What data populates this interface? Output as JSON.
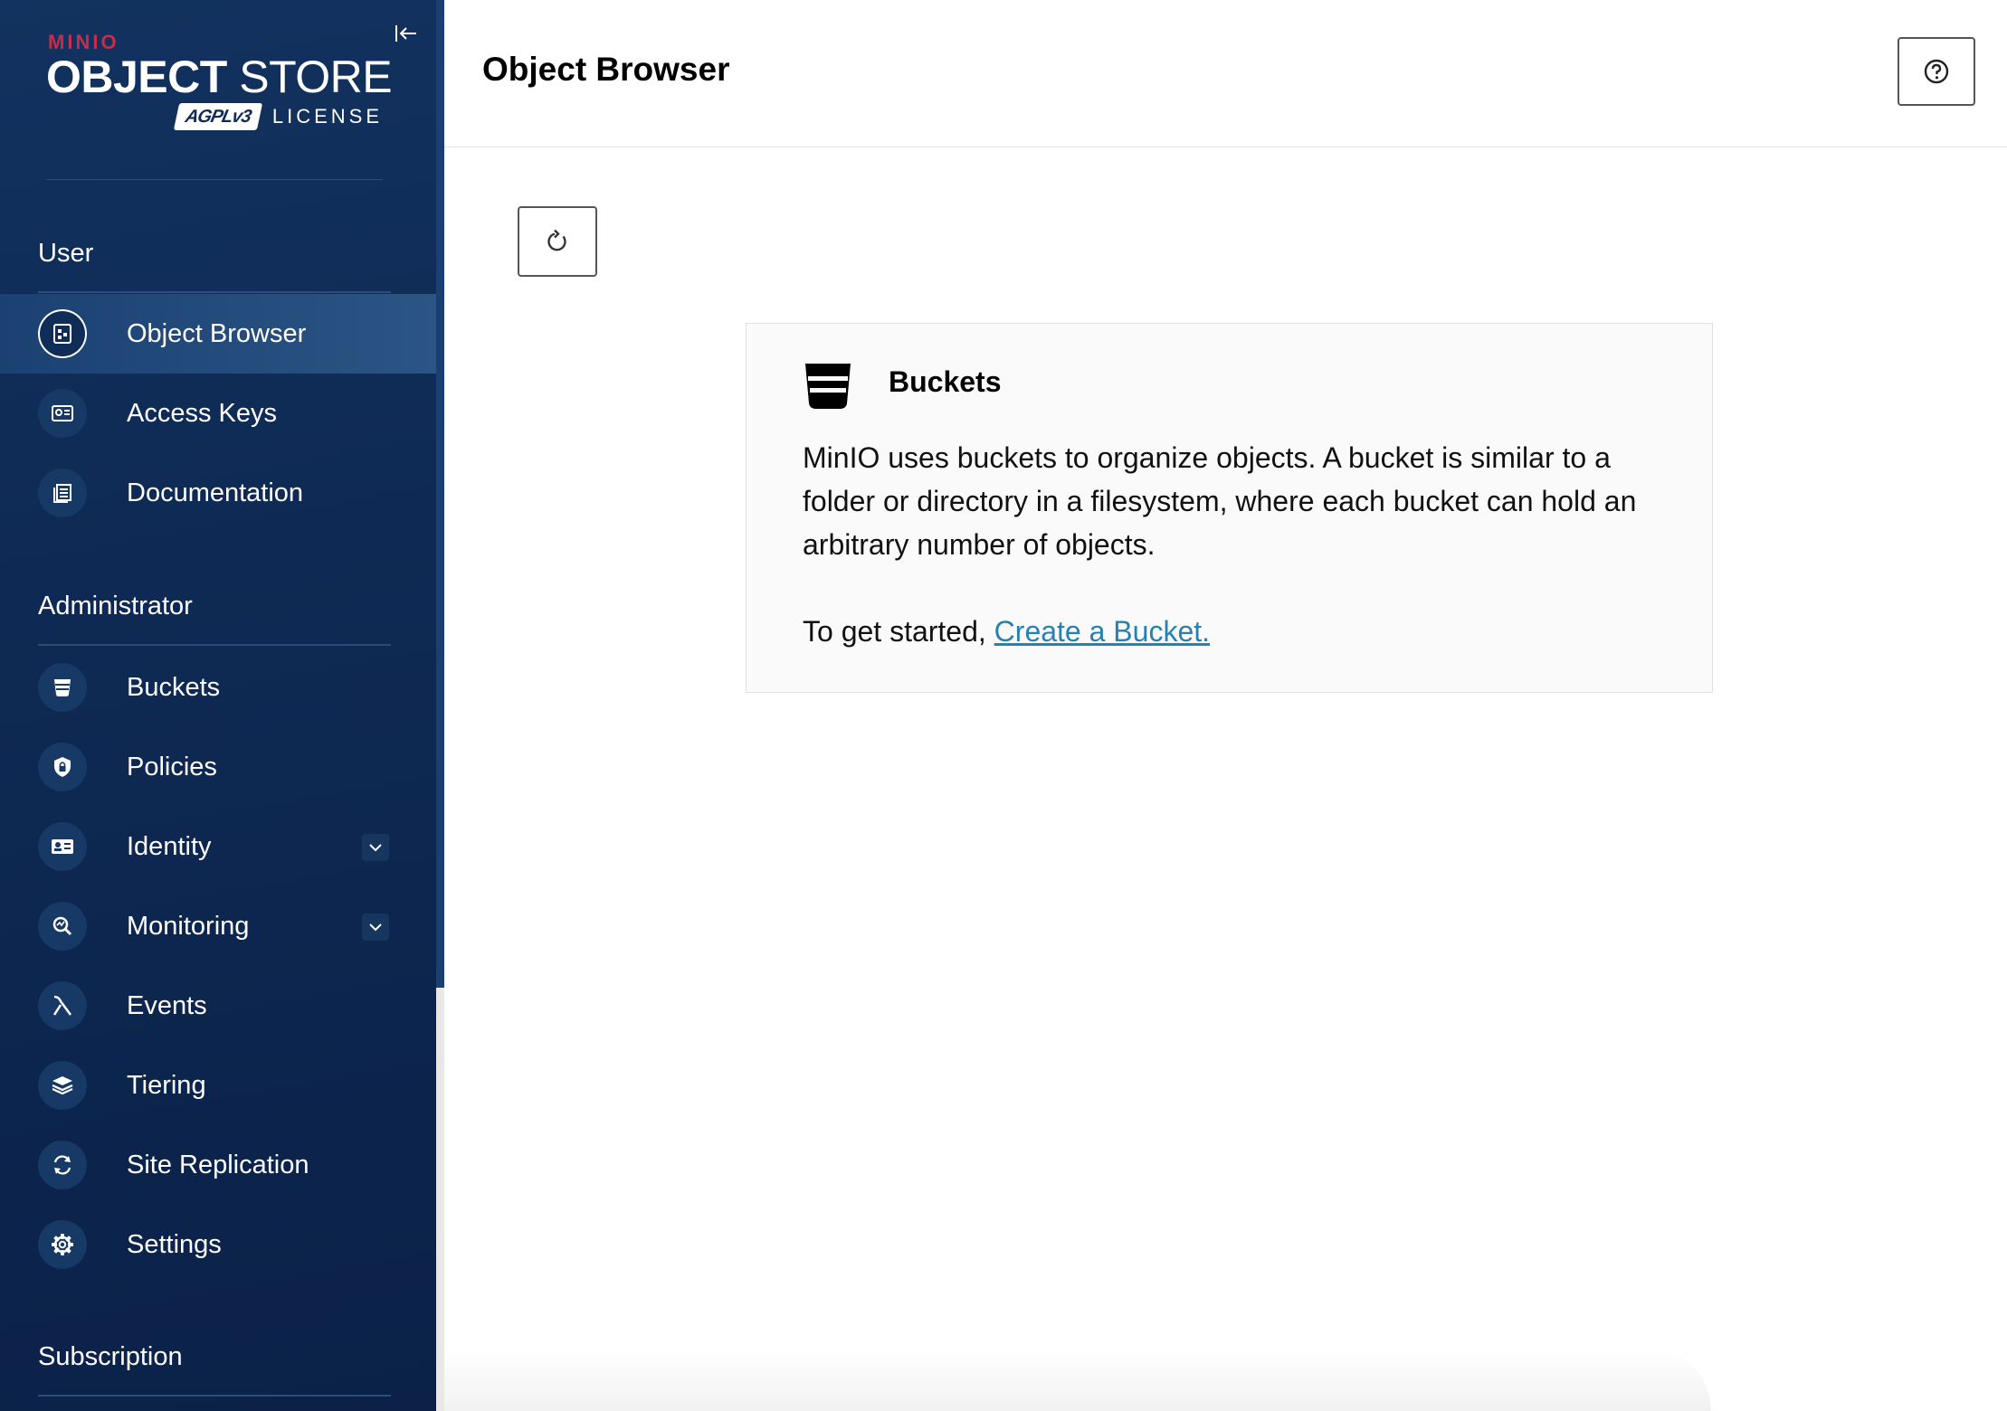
{
  "brand": {
    "vendor": "MINIO",
    "product_bold": "OBJECT",
    "product_light": "STORE",
    "badge": "AGPLv3",
    "license": "LICENSE"
  },
  "sidebar": {
    "sections": [
      {
        "title": "User"
      },
      {
        "title": "Administrator"
      },
      {
        "title": "Subscription"
      }
    ],
    "user_items": [
      {
        "label": "Object Browser",
        "icon": "object-browser-icon",
        "active": true
      },
      {
        "label": "Access Keys",
        "icon": "access-keys-icon"
      },
      {
        "label": "Documentation",
        "icon": "documentation-icon"
      }
    ],
    "admin_items": [
      {
        "label": "Buckets",
        "icon": "bucket-icon"
      },
      {
        "label": "Policies",
        "icon": "policy-shield-icon"
      },
      {
        "label": "Identity",
        "icon": "identity-card-icon",
        "expandable": true
      },
      {
        "label": "Monitoring",
        "icon": "monitoring-icon",
        "expandable": true
      },
      {
        "label": "Events",
        "icon": "lambda-icon"
      },
      {
        "label": "Tiering",
        "icon": "tiering-layers-icon"
      },
      {
        "label": "Site Replication",
        "icon": "site-replication-icon"
      },
      {
        "label": "Settings",
        "icon": "gear-icon"
      }
    ]
  },
  "header": {
    "title": "Object Browser"
  },
  "card": {
    "title": "Buckets",
    "description": "MinIO uses buckets to organize objects. A bucket is similar to a folder or directory in a filesystem, where each bucket can hold an arbitrary number of objects.",
    "cta_prefix": "To get started, ",
    "cta_link": "Create a Bucket."
  },
  "colors": {
    "sidebar_bg": "#0e2a54",
    "brand_red": "#c72c48",
    "link": "#2781b0"
  }
}
